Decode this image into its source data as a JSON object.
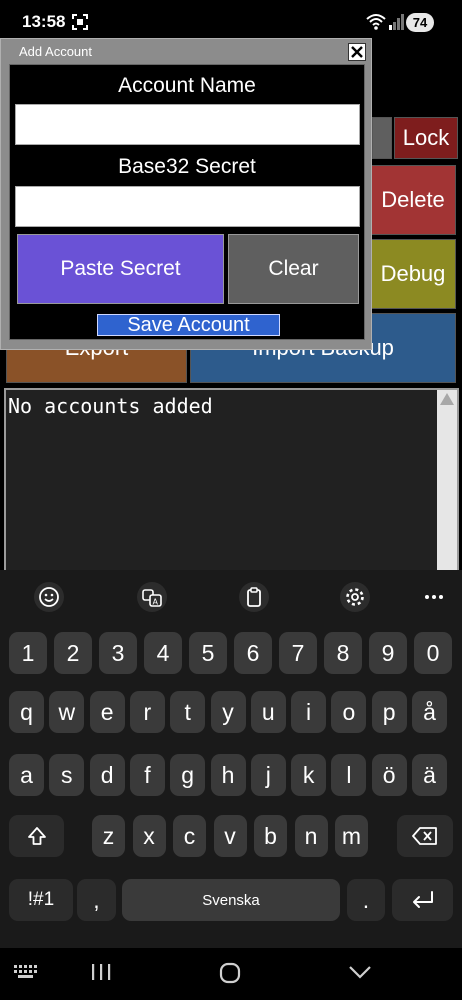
{
  "status_bar": {
    "time": "13:58",
    "battery": "74"
  },
  "background_app": {
    "lock_label": "Lock",
    "delete_label": "Delete",
    "debug_label": "Debug",
    "export_label": "Export",
    "import_label": "Import Backup",
    "accounts_text": "No accounts added"
  },
  "dialog": {
    "title": "Add Account",
    "account_name_label": "Account Name",
    "account_name_value": "",
    "secret_label": "Base32 Secret",
    "secret_value": "",
    "paste_label": "Paste Secret",
    "clear_label": "Clear",
    "save_label": "Save Account"
  },
  "keyboard": {
    "toolbar_icons": [
      "emoji-icon",
      "translate-icon",
      "clipboard-icon",
      "settings-icon",
      "more-icon"
    ],
    "number_row": [
      "1",
      "2",
      "3",
      "4",
      "5",
      "6",
      "7",
      "8",
      "9",
      "0"
    ],
    "row1": [
      "q",
      "w",
      "e",
      "r",
      "t",
      "y",
      "u",
      "i",
      "o",
      "p",
      "å"
    ],
    "row2": [
      "a",
      "s",
      "d",
      "f",
      "g",
      "h",
      "j",
      "k",
      "l",
      "ö",
      "ä"
    ],
    "row3": [
      "z",
      "x",
      "c",
      "v",
      "b",
      "n",
      "m"
    ],
    "symbols_label": "!#1",
    "comma_label": ",",
    "space_label": "Svenska",
    "period_label": "."
  },
  "colors": {
    "lock": "#7e1d1d",
    "delete": "#a23434",
    "debug": "#8c8a22",
    "export": "#8a5228",
    "import": "#2d5b8c",
    "paste": "#6a52d6",
    "clear": "#5f5f5f",
    "save": "#2f63cf"
  }
}
